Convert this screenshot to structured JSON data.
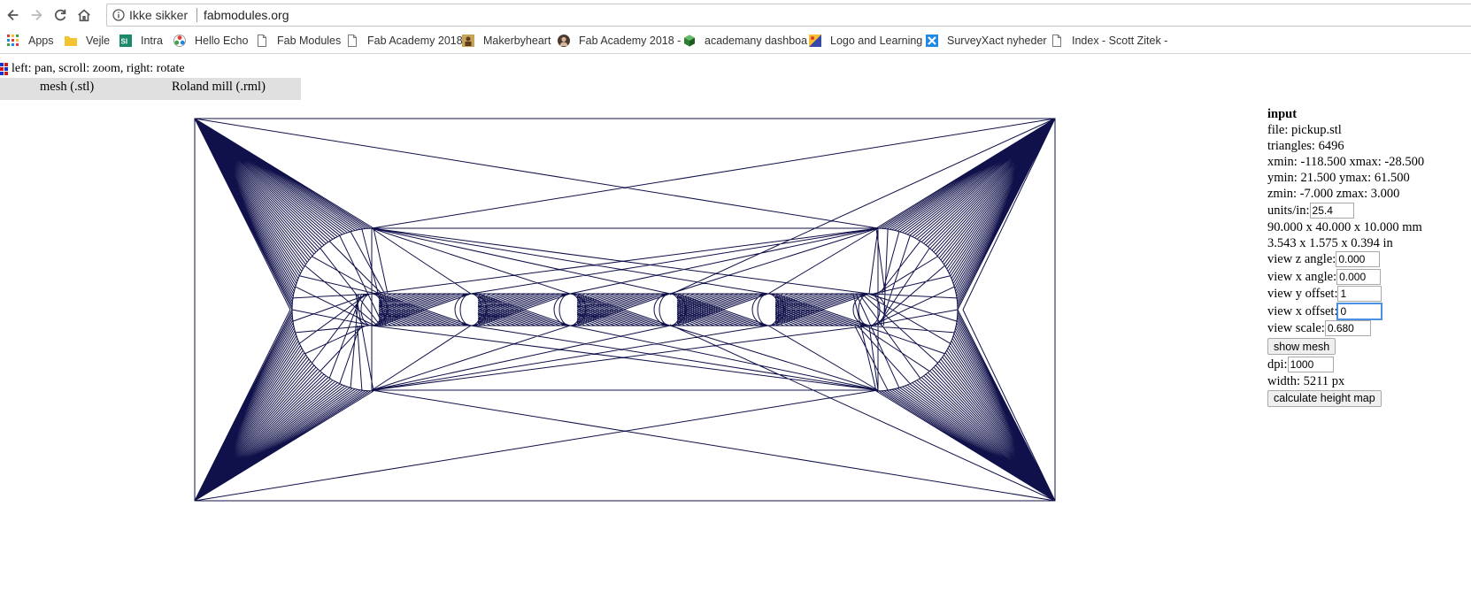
{
  "browser": {
    "security_label": "Ikke sikker",
    "url": "fabmodules.org",
    "bookmarks": [
      {
        "label": "Apps",
        "icon": "apps-grid-icon"
      },
      {
        "label": "Vejle",
        "icon": "folder-icon"
      },
      {
        "label": "Intra",
        "icon": "si-logo-icon"
      },
      {
        "label": "Hello Echo",
        "icon": "fablab-logo-icon"
      },
      {
        "label": "Fab Modules",
        "icon": "page-icon"
      },
      {
        "label": "Fab Academy 2018",
        "icon": "page-icon"
      },
      {
        "label": "Makerbyheart",
        "icon": "makerbyheart-icon"
      },
      {
        "label": "Fab Academy 2018 -",
        "icon": "avatar-icon"
      },
      {
        "label": "academany dashboa",
        "icon": "cube-icon"
      },
      {
        "label": "Logo and Learning",
        "icon": "logo-learning-icon"
      },
      {
        "label": "SurveyXact nyheder",
        "icon": "surveyxact-icon"
      },
      {
        "label": "Index - Scott Zitek -",
        "icon": "page-icon"
      }
    ]
  },
  "page": {
    "hint": "left: pan, scroll: zoom, right: rotate",
    "menu": {
      "input_format": "mesh (.stl)",
      "output_format": "Roland mill (.rml)"
    }
  },
  "panel": {
    "heading": "input",
    "file": "file: pickup.stl",
    "triangles": "triangles: 6496",
    "x_range": "xmin: -118.500 xmax: -28.500",
    "y_range": "ymin: 21.500 ymax: 61.500",
    "z_range": "zmin: -7.000 zmax: 3.000",
    "units_label": "units/in:",
    "units_value": "25.4",
    "size_mm": "90.000 x 40.000 x 10.000 mm",
    "size_in": "3.543 x 1.575 x 0.394 in",
    "view_z_angle_label": "view z angle:",
    "view_z_angle_value": "0.000",
    "view_x_angle_label": "view x angle:",
    "view_x_angle_value": "0.000",
    "view_y_offset_label": "view y offset:",
    "view_y_offset_value": "1",
    "view_x_offset_label": "view x offset:",
    "view_x_offset_value": "0",
    "view_scale_label": "view scale: ",
    "view_scale_value": "0.680",
    "show_mesh_label": "show mesh",
    "dpi_label": "dpi: ",
    "dpi_value": "1000",
    "width": "width: 5211 px",
    "calc_label": "calculate height map"
  },
  "colors": {
    "mesh_stroke": "#10104a",
    "menubar_bg": "#e0e0e0"
  }
}
